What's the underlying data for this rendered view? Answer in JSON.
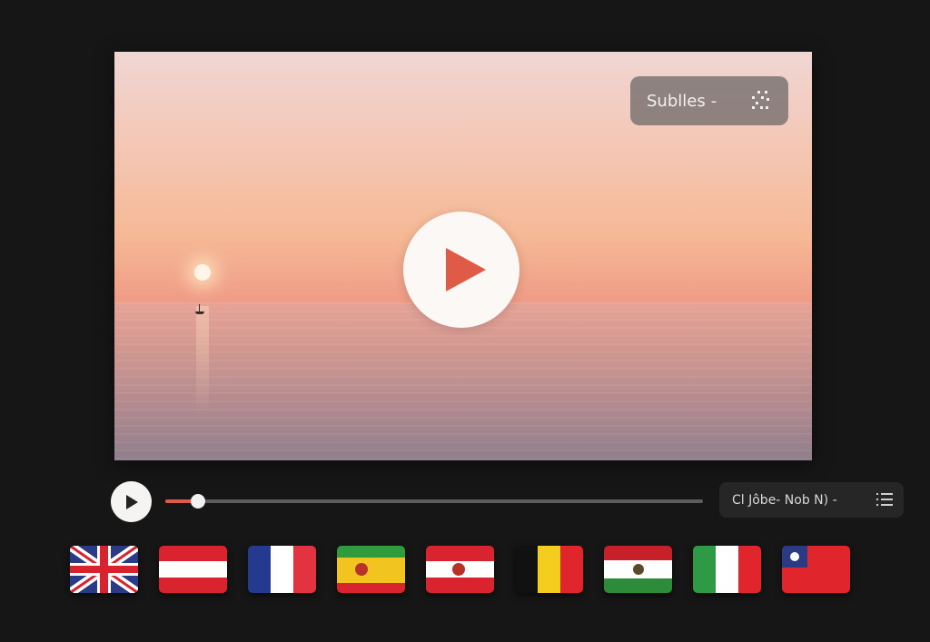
{
  "video": {
    "overlay_subtitles_label": "Sublles",
    "overlay_chevron": "-",
    "icons": {
      "center_play": "play-icon",
      "subtitles": "subtitle-grid-icon"
    }
  },
  "controls": {
    "progress_fraction": 0.06,
    "subtitle_selector_label": "Cl Jôbe- Nob N) -",
    "icons": {
      "play": "play-icon",
      "list": "list-icon"
    },
    "accent_color": "#e05a48"
  },
  "languages": [
    {
      "name": "uk-flag",
      "colors": [
        "#2a3a84",
        "#ffffff",
        "#d8222d"
      ]
    },
    {
      "name": "austria-flag",
      "colors": [
        "#d9232f",
        "#ffffff",
        "#d9232f"
      ]
    },
    {
      "name": "france-flag",
      "colors": [
        "#243a8e",
        "#ffffff",
        "#e33340"
      ]
    },
    {
      "name": "yellow-green-flag",
      "colors": [
        "#2f9b3c",
        "#f2c420",
        "#d9232f"
      ]
    },
    {
      "name": "spain-like-flag",
      "colors": [
        "#d9232f",
        "#ffffff",
        "#d9232f"
      ]
    },
    {
      "name": "belgium-flag",
      "colors": [
        "#111111",
        "#f4cd1f",
        "#e0252d"
      ]
    },
    {
      "name": "mexico-like-flag",
      "colors": [
        "#c8202a",
        "#ffffff",
        "#2e8b3a"
      ]
    },
    {
      "name": "italy-flag",
      "colors": [
        "#2e9a45",
        "#ffffff",
        "#e0252d"
      ]
    },
    {
      "name": "taiwan-like-flag",
      "colors": [
        "#e0252d",
        "#2a3a84",
        "#ffffff"
      ]
    }
  ]
}
